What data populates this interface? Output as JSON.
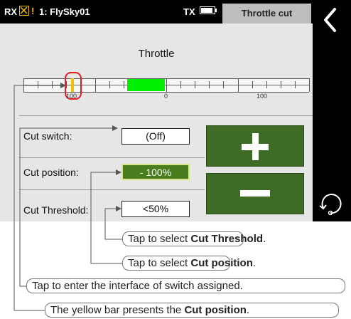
{
  "status_bar": {
    "rx_label": "RX",
    "warning_mark": "!",
    "model_name": "1: FlySky01",
    "tx_label": "TX",
    "page_title": "Throttle cut"
  },
  "throttle": {
    "title": "Throttle",
    "scale_labels": [
      "100",
      "0",
      "100"
    ],
    "cut_position_percent": -100
  },
  "rows": {
    "cut_switch_label": "Cut  switch:",
    "cut_switch_value": "(Off)",
    "cut_position_label": "Cut  position:",
    "cut_position_value": "- 100%",
    "cut_threshold_label": "Cut  Threshold:",
    "cut_threshold_value": "<50%"
  },
  "buttons": {
    "increase_icon": "plus-icon",
    "decrease_icon": "minus-icon",
    "back_icon": "chevron-left-icon",
    "rotate_icon": "rotate-icon"
  },
  "callouts": {
    "threshold_prefix": "Tap to select ",
    "threshold_bold": "Cut Threshold",
    "threshold_suffix": ".",
    "position_prefix": "Tap to select ",
    "position_bold": "Cut position",
    "position_suffix": ".",
    "switch_text": "Tap to enter the interface of switch assigned.",
    "bar_prefix": "The yellow bar presents the ",
    "bar_bold": "Cut position",
    "bar_suffix": "."
  },
  "colors": {
    "cut_position_field": "#4a7d1d",
    "center_bar": "#00ee00",
    "cut_marker": "#f2c200",
    "button_fill": "#3e6b26"
  }
}
